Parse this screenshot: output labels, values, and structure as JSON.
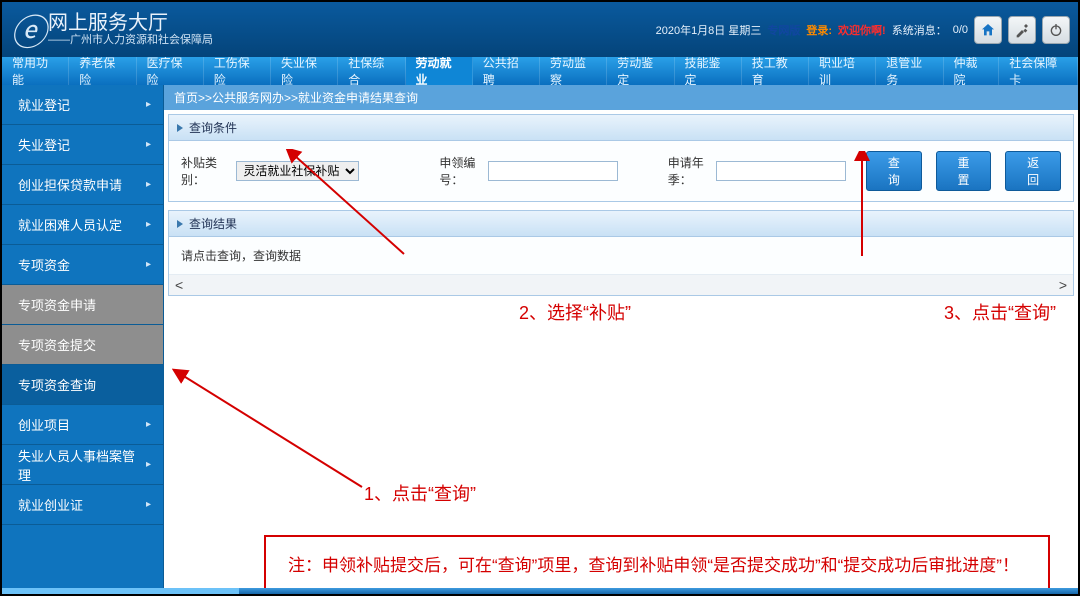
{
  "header": {
    "title": "网上服务大厅",
    "subtitle": "——广州市人力资源和社会保障局",
    "date": "2020年1月8日 星期三",
    "version": "专网版",
    "login_label": "登录:",
    "welcome": "欢迎你啊!",
    "sysmsg_label": "系统消息：",
    "sysmsg_count": "0/0"
  },
  "nav": {
    "items": [
      "常用功能",
      "养老保险",
      "医疗保险",
      "工伤保险",
      "失业保险",
      "社保综合",
      "劳动就业",
      "公共招聘",
      "劳动监察",
      "劳动鉴定",
      "技能鉴定",
      "技工教育",
      "职业培训",
      "退管业务",
      "仲裁院",
      "社会保障卡"
    ],
    "active_index": 6
  },
  "sidebar": {
    "items": [
      {
        "label": "就业登记",
        "sub": true
      },
      {
        "label": "失业登记",
        "sub": true
      },
      {
        "label": "创业担保贷款申请",
        "sub": true
      },
      {
        "label": "就业困难人员认定",
        "sub": true
      },
      {
        "label": "专项资金",
        "sub": true
      },
      {
        "label": "专项资金申请",
        "sub": false
      },
      {
        "label": "专项资金提交",
        "sub": false
      },
      {
        "label": "专项资金查询",
        "sub": false,
        "active": true
      },
      {
        "label": "创业项目",
        "sub": true
      },
      {
        "label": "失业人员人事档案管理",
        "sub": true
      },
      {
        "label": "就业创业证",
        "sub": true
      }
    ]
  },
  "breadcrumb": "首页>>公共服务网办>>就业资金申请结果查询",
  "query_panel": {
    "title": "查询条件",
    "subsidy_label": "补贴类别：",
    "subsidy_value": "灵活就业社保补贴",
    "apply_no_label": "申领编号：",
    "apply_no_value": "",
    "apply_year_label": "申请年季：",
    "apply_year_value": "",
    "btn_query": "查 询",
    "btn_reset": "重 置",
    "btn_back": "返 回"
  },
  "result_panel": {
    "title": "查询结果",
    "empty_msg": "请点击查询，查询数据"
  },
  "annotations": {
    "a1": "1、点击“查询”",
    "a2": "2、选择“补贴”",
    "a3": "3、点击“查询”",
    "note": "注：申领补贴提交后，可在“查询”项里，查询到补贴申领“是否提交成功”和“提交成功后审批进度”！"
  }
}
